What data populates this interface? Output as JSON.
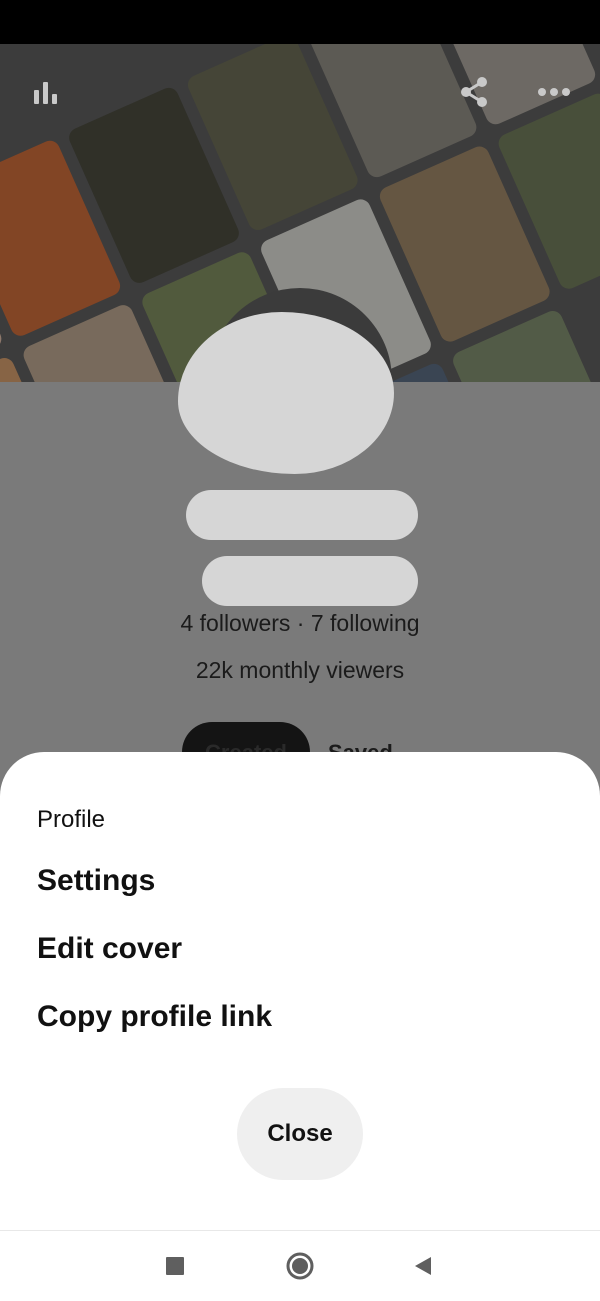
{
  "colors": {
    "scrim": "#7a7a7a",
    "sheet_bg": "#ffffff",
    "close_bg": "#efefef",
    "text": "#111111",
    "status_bar": "#000000"
  },
  "cover": {
    "icons": [
      "analytics-icon",
      "share-icon",
      "more-icon"
    ]
  },
  "profile": {
    "stats": "4 followers · 7 following",
    "monthly_viewers": "22k monthly viewers",
    "tabs": [
      "Created",
      "Saved"
    ]
  },
  "sheet": {
    "title": "Profile",
    "items": [
      "Settings",
      "Edit cover",
      "Copy profile link"
    ],
    "close_label": "Close"
  },
  "system_nav": {
    "icons": [
      "recents-icon",
      "home-icon",
      "back-icon"
    ]
  }
}
